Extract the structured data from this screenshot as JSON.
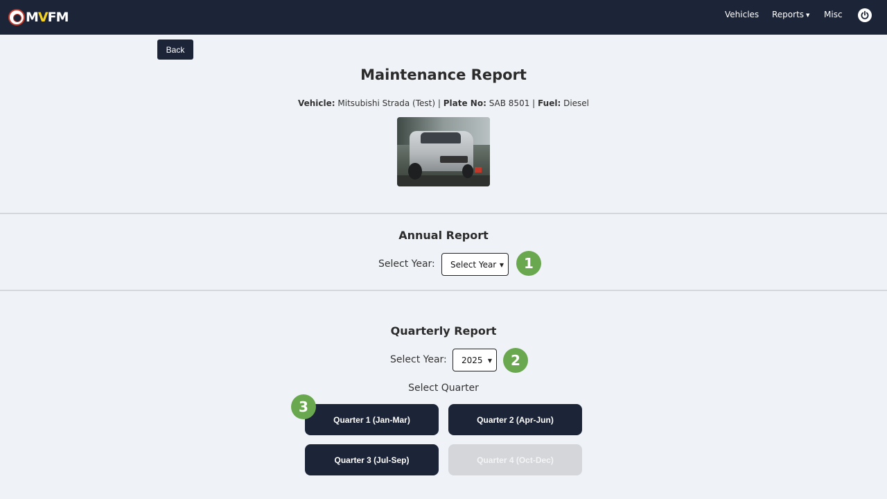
{
  "navbar": {
    "logo_text_1": "M",
    "logo_text_2": "V",
    "logo_text_3": "FM",
    "links": {
      "vehicles": "Vehicles",
      "reports": "Reports",
      "reports_caret": "▼",
      "misc": "Misc"
    },
    "power_icon": "power-icon"
  },
  "back_label": "Back",
  "page_title": "Maintenance Report",
  "vehicle": {
    "vehicle_label": "Vehicle:",
    "vehicle_value": "Mitsubishi Strada (Test)",
    "sep1": "|",
    "plate_label": "Plate No:",
    "plate_value": "SAB 8501",
    "sep2": "|",
    "fuel_label": "Fuel:",
    "fuel_value": "Diesel"
  },
  "annual": {
    "title": "Annual Report",
    "select_label": "Select Year:",
    "select_value": "Select Year"
  },
  "quarterly": {
    "title": "Quarterly Report",
    "select_label": "Select Year:",
    "select_value": "2025",
    "select_quarter_label": "Select Quarter",
    "buttons": [
      {
        "label": "Quarter 1 (Jan-Mar)",
        "enabled": true
      },
      {
        "label": "Quarter 2 (Apr-Jun)",
        "enabled": true
      },
      {
        "label": "Quarter 3 (Jul-Sep)",
        "enabled": true
      },
      {
        "label": "Quarter 4 (Oct-Dec)",
        "enabled": false
      }
    ]
  },
  "markers": [
    "1",
    "2",
    "3"
  ],
  "colors": {
    "navbar": "#1c2438",
    "accent_green": "#6aa84f",
    "logo_yellow": "#f4d21f",
    "disabled": "#d4d6d9"
  }
}
